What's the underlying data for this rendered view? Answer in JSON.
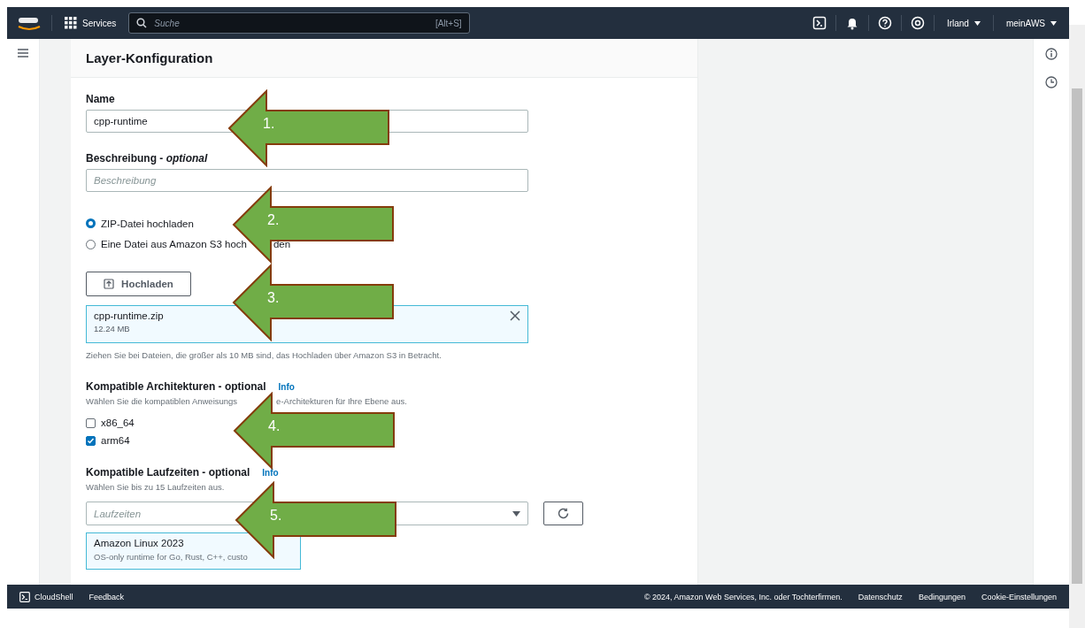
{
  "top_nav": {
    "services": "Services",
    "search": {
      "placeholder": "Suche",
      "shortcut": "[Alt+S]"
    },
    "region": "Irland",
    "account": "meinAWS"
  },
  "panel": {
    "title": "Layer-Konfiguration",
    "name": {
      "label": "Name",
      "value": "cpp-runtime"
    },
    "description": {
      "label": "Beschreibung - ",
      "label_optional": "optional",
      "placeholder": "Beschreibung"
    },
    "source_options": [
      {
        "label": "ZIP-Datei hochladen",
        "selected": true
      },
      {
        "label": "Eine Datei aus Amazon S3 hoch",
        "label_tail": "den",
        "selected": false
      }
    ],
    "upload_button": "Hochladen",
    "file": {
      "name": "cpp-runtime.zip",
      "size": "12.24 MB"
    },
    "upload_hint": "Ziehen Sie bei Dateien, die größer als 10 MB sind, das Hochladen über Amazon S3 in Betracht.",
    "architectures": {
      "label": "Kompatible Architekturen - optional",
      "info": "Info",
      "hint": "Wählen Sie die kompatiblen Anweisungs",
      "hint_tail": "e-Architekturen für Ihre Ebene aus.",
      "options": [
        {
          "label": "x86_64",
          "checked": false
        },
        {
          "label": "arm64",
          "checked": true
        }
      ]
    },
    "runtimes": {
      "label": "Kompatible Laufzeiten - optional",
      "info": "Info",
      "hint": "Wählen Sie bis zu 15 Laufzeiten aus.",
      "placeholder": "Laufzeiten",
      "selected": [
        {
          "name": "Amazon Linux 2023",
          "description": "OS-only runtime for Go, Rust, C++, custo"
        }
      ]
    }
  },
  "annotations": [
    {
      "label": "1."
    },
    {
      "label": "2."
    },
    {
      "label": "3."
    },
    {
      "label": "4."
    },
    {
      "label": "5."
    }
  ],
  "footer": {
    "cloudshell": "CloudShell",
    "feedback": "Feedback",
    "copyright": "© 2024, Amazon Web Services, Inc. oder Tochterfirmen.",
    "links": [
      "Datenschutz",
      "Bedingungen",
      "Cookie-Einstellungen"
    ]
  }
}
